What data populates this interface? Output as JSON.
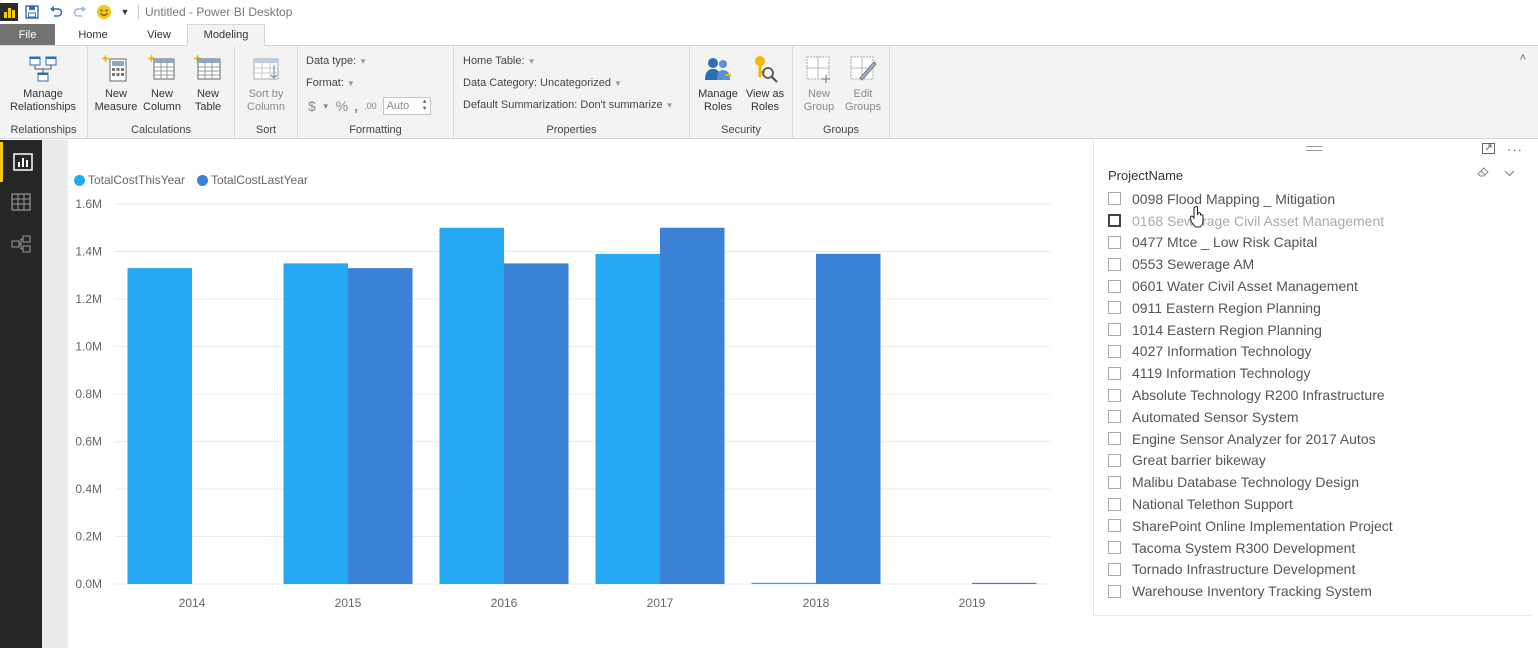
{
  "titlebar": {
    "title": "Untitled - Power BI Desktop"
  },
  "tabs": [
    {
      "label": "File"
    },
    {
      "label": "Home"
    },
    {
      "label": "View"
    },
    {
      "label": "Modeling"
    }
  ],
  "ribbon": {
    "relationships": {
      "manage_line1": "Manage",
      "manage_line2": "Relationships",
      "group": "Relationships"
    },
    "calculations": {
      "new_measure_1": "New",
      "new_measure_2": "Measure",
      "new_column_1": "New",
      "new_column_2": "Column",
      "new_table_1": "New",
      "new_table_2": "Table",
      "group": "Calculations"
    },
    "sort": {
      "line1": "Sort by",
      "line2": "Column",
      "group": "Sort"
    },
    "formatting": {
      "data_type": "Data type:",
      "format": "Format:",
      "currency": "$",
      "percent": "%",
      "comma": ",",
      "decimals": ".00",
      "auto": "Auto",
      "group": "Formatting"
    },
    "properties": {
      "home_table": "Home Table:",
      "data_category": "Data Category: Uncategorized",
      "default_summarization": "Default Summarization: Don't summarize",
      "group": "Properties"
    },
    "security": {
      "manage_roles_1": "Manage",
      "manage_roles_2": "Roles",
      "view_as_1": "View as",
      "view_as_2": "Roles",
      "group": "Security"
    },
    "groups": {
      "new_group_1": "New",
      "new_group_2": "Group",
      "edit_groups_1": "Edit",
      "edit_groups_2": "Groups",
      "group": "Groups"
    }
  },
  "colors": {
    "this_year": "#26a9f5",
    "last_year": "#3b82d6",
    "accent": "#f2c811"
  },
  "chart_data": {
    "type": "bar",
    "categories": [
      "2014",
      "2015",
      "2016",
      "2017",
      "2018",
      "2019"
    ],
    "series": [
      {
        "name": "TotalCostThisYear",
        "values": [
          1.33,
          1.35,
          1.5,
          1.39,
          0.005,
          0.0
        ]
      },
      {
        "name": "TotalCostLastYear",
        "values": [
          0.0,
          1.33,
          1.35,
          1.5,
          1.39,
          0.005
        ]
      }
    ],
    "ytick_labels": [
      "0.0M",
      "0.2M",
      "0.4M",
      "0.6M",
      "0.8M",
      "1.0M",
      "1.2M",
      "1.4M",
      "1.6M"
    ],
    "ylim": [
      0,
      1.6
    ],
    "grid": true,
    "legend": "top-left"
  },
  "slicer": {
    "title": "ProjectName",
    "items": [
      "0098 Flood Mapping _ Mitigation",
      "0168 Sewerage Civil Asset Management",
      "0477 Mtce _ Low Risk Capital",
      "0553 Sewerage AM",
      "0601 Water Civil Asset Management",
      "0911 Eastern Region Planning",
      "1014 Eastern Region Planning",
      "4027 Information Technology",
      "4119 Information Technology",
      "Absolute Technology R200 Infrastructure",
      "Automated Sensor System",
      "Engine Sensor Analyzer for 2017 Autos",
      "Great barrier bikeway",
      "Malibu Database Technology Design",
      "National Telethon Support",
      "SharePoint Online Implementation Project",
      "Tacoma System R300 Development",
      "Tornado Infrastructure Development",
      "Warehouse Inventory Tracking System"
    ]
  }
}
